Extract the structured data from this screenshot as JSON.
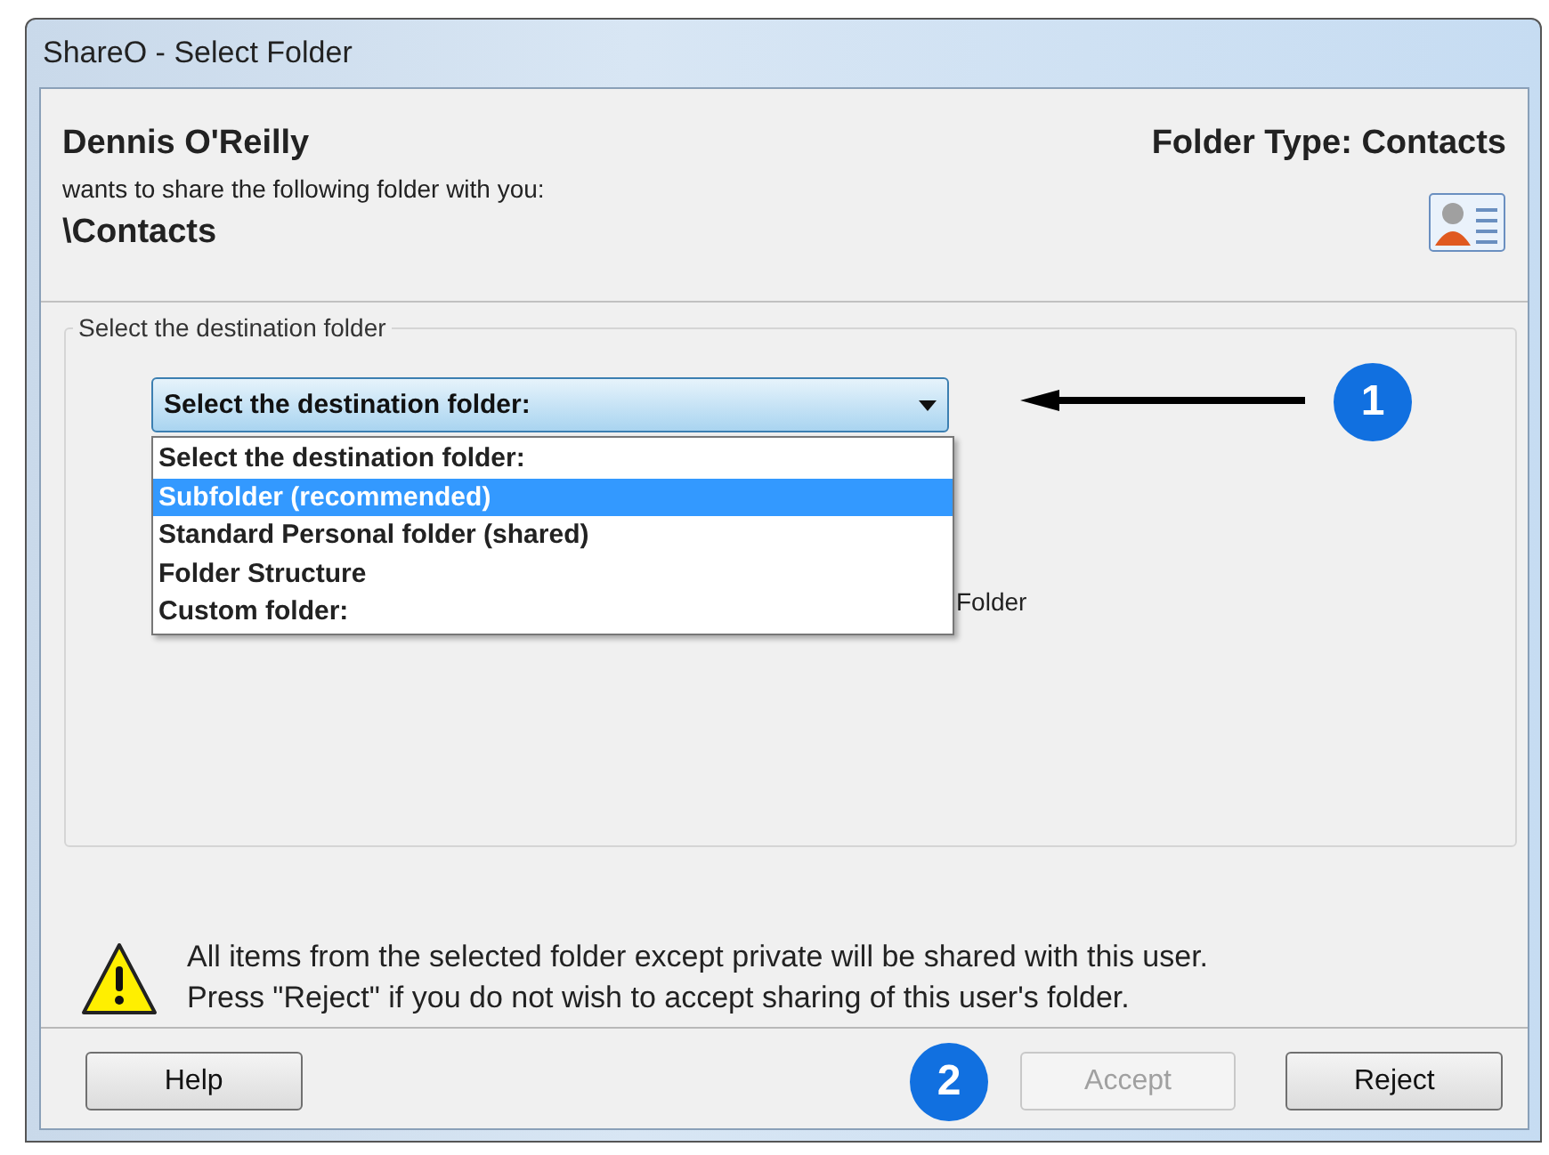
{
  "window": {
    "title": "ShareO - Select Folder"
  },
  "header": {
    "sender": "Dennis O'Reilly",
    "message": "wants to share the following folder with you:",
    "folder_path": "\\Contacts",
    "folder_type": "Folder Type: Contacts"
  },
  "destination": {
    "legend": "Select the destination folder",
    "combo_value": "Select the destination folder:",
    "expanded": true,
    "options": [
      {
        "label": "Select the destination folder:",
        "selected": false
      },
      {
        "label": "Subfolder (recommended)",
        "selected": true
      },
      {
        "label": "Standard Personal folder (shared)",
        "selected": false
      },
      {
        "label": "Folder Structure",
        "selected": false
      },
      {
        "label": "Custom folder:",
        "selected": false
      }
    ],
    "hidden_label": "Folder"
  },
  "callouts": [
    {
      "label": "1"
    },
    {
      "label": "2"
    }
  ],
  "warning": {
    "lines": [
      "All items from the selected folder except private will be shared with this user.",
      "Press \"Reject\" if you do not wish to accept sharing of this user's folder."
    ]
  },
  "buttons": [
    {
      "label": "Help",
      "disabled": false
    },
    {
      "label": "Accept",
      "disabled": true
    },
    {
      "label": "Reject",
      "disabled": false
    }
  ]
}
